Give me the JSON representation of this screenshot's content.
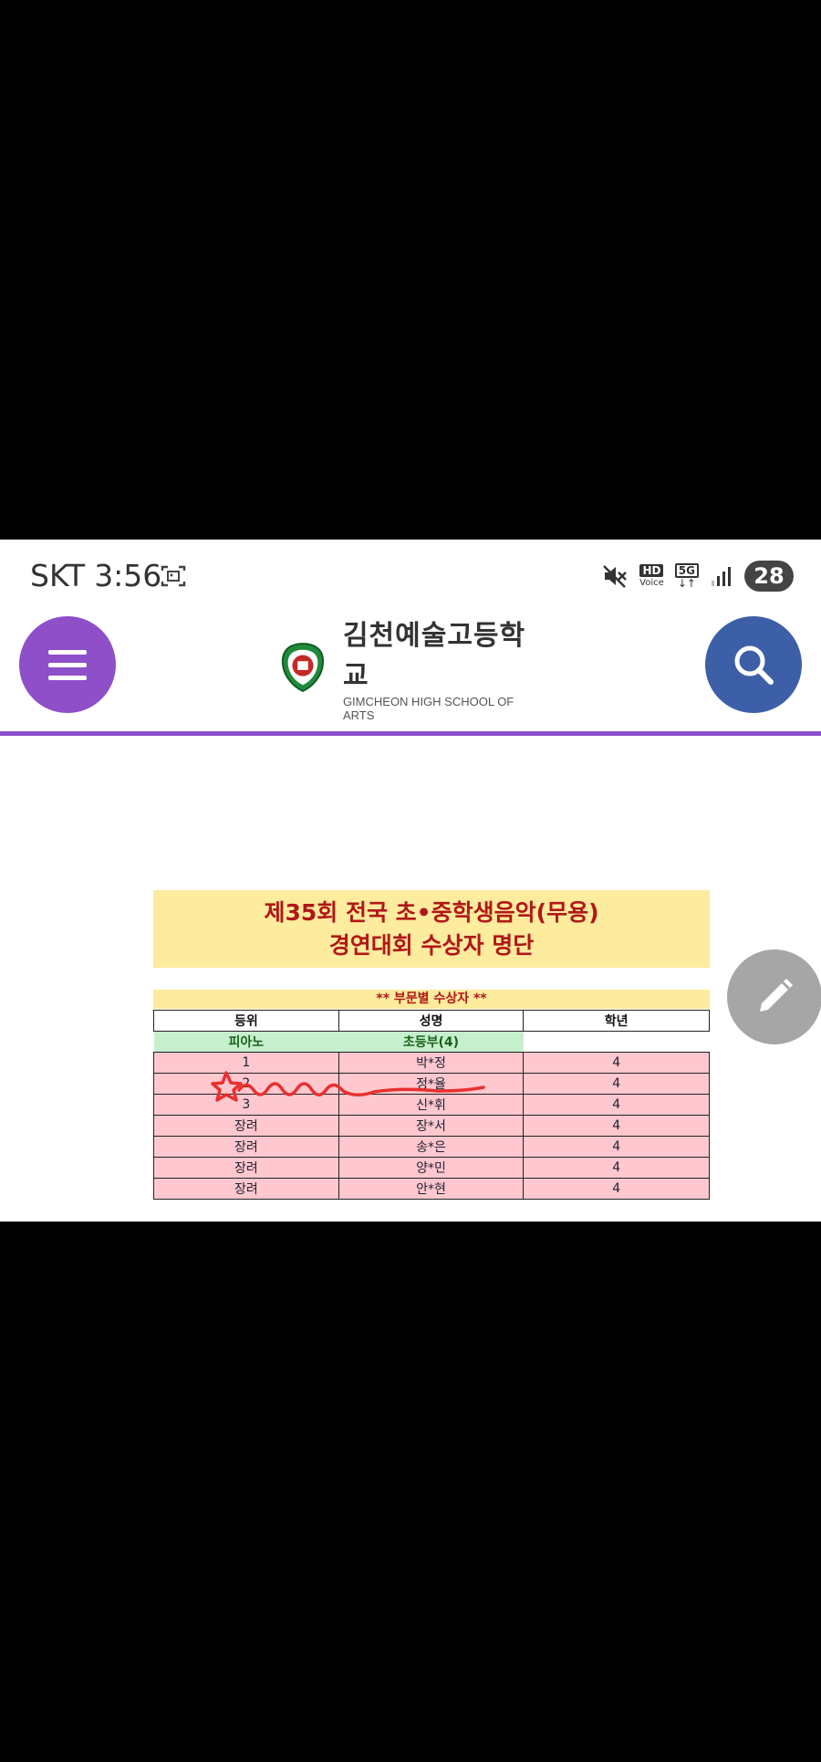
{
  "status_bar": {
    "carrier": "SKT",
    "time": "3:56",
    "hd_label": "HD",
    "voice_label": "Voice",
    "network": "5G",
    "battery": "28"
  },
  "header": {
    "school_name_ko": "김천예술고등학교",
    "school_name_en": "GIMCHEON HIGH SCHOOL OF ARTS"
  },
  "document": {
    "title_line1": "제35회 전국 초•중학생음악(무용)",
    "title_line2": "경연대회 수상자 명단",
    "subtitle": "** 부문별 수상자 **",
    "columns": [
      "등위",
      "성명",
      "학년"
    ],
    "section": {
      "category": "피아노",
      "division": "초등부(4)"
    },
    "rows": [
      {
        "rank": "1",
        "name": "박*정",
        "grade": "4"
      },
      {
        "rank": "2",
        "name": "정*율",
        "grade": "4"
      },
      {
        "rank": "3",
        "name": "신*휘",
        "grade": "4"
      },
      {
        "rank": "장려",
        "name": "장*서",
        "grade": "4"
      },
      {
        "rank": "장려",
        "name": "송*은",
        "grade": "4"
      },
      {
        "rank": "장려",
        "name": "양*민",
        "grade": "4"
      },
      {
        "rank": "장려",
        "name": "안*현",
        "grade": "4"
      }
    ]
  },
  "colors": {
    "menu": "#8e4fc9",
    "search": "#3d5fa8",
    "title_bg": "#fdeb9e",
    "title_text": "#b01818",
    "row_bg": "#ffc7ce",
    "section_bg": "#c6efce",
    "annotation": "#e8302f"
  }
}
